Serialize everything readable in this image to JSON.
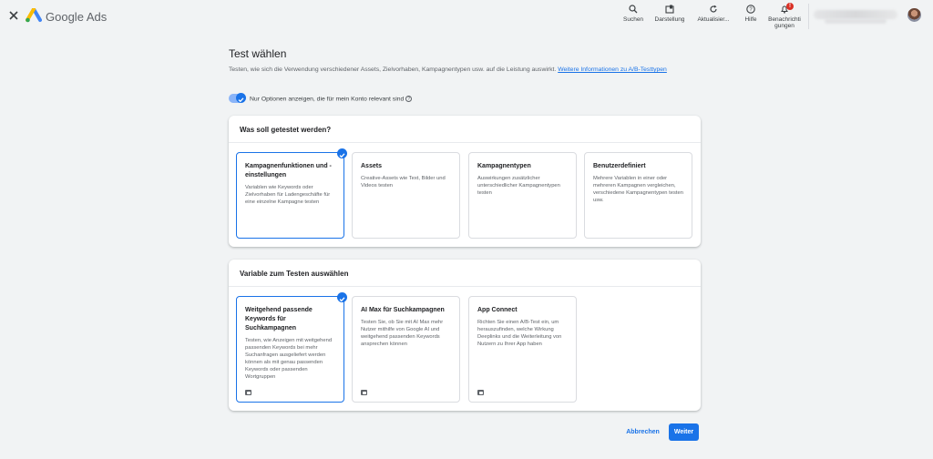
{
  "app": {
    "brand": "Google Ads"
  },
  "toolbar": [
    {
      "label": "Suchen",
      "icon": "search-icon"
    },
    {
      "label": "Darstellung",
      "icon": "appearance-icon"
    },
    {
      "label": "Aktualisier...",
      "icon": "refresh-icon"
    },
    {
      "label": "Hilfe",
      "icon": "help-icon"
    },
    {
      "label": "Benachrichti gungen",
      "icon": "bell-icon",
      "badge": "!"
    }
  ],
  "page": {
    "title": "Test wählen",
    "description": "Testen, wie sich die Verwendung verschiedener Assets, Zielvorhaben, Kampagnentypen usw. auf die Leistung auswirkt. ",
    "learn_more": "Weitere Informationen zu A/B-Testtypen",
    "toggle_label": "Nur Optionen anzeigen, die für mein Konto relevant sind"
  },
  "section1": {
    "title": "Was soll getestet werden?",
    "cards": [
      {
        "title": "Kampagnenfunktionen und -einstellungen",
        "desc": "Variablen wie Keywords oder Zielvorhaben für Ladengeschäfte für eine einzelne Kampagne testen",
        "selected": true
      },
      {
        "title": "Assets",
        "desc": "Creative-Assets wie Text, Bilder und Videos testen",
        "selected": false
      },
      {
        "title": "Kampagnentypen",
        "desc": "Auswirkungen zusätzlicher unterschiedlicher Kampagnentypen testen",
        "selected": false
      },
      {
        "title": "Benutzerdefiniert",
        "desc": "Mehrere Variablen in einer oder mehreren Kampagnen vergleichen, verschiedene Kampagnentypen testen usw.",
        "selected": false
      }
    ]
  },
  "section2": {
    "title": "Variable zum Testen auswählen",
    "cards": [
      {
        "title": "Weitgehend passende Keywords für Suchkampagnen",
        "desc": "Testen, wie Anzeigen mit weitgehend passenden Keywords bei mehr Suchanfragen ausgeliefert werden können als mit genau passenden Keywords oder passenden Wortgruppen",
        "selected": true
      },
      {
        "title": "AI Max für Suchkampagnen",
        "desc": "Testen Sie, ob Sie mit AI Max mehr Nutzer mithilfe von Google AI und weitgehend passenden Keywords ansprechen können",
        "selected": false
      },
      {
        "title": "App Connect",
        "desc": "Richten Sie einen A/B-Test ein, um herauszufinden, welche Wirkung Deeplinks und die Weiterleitung von Nutzern zu Ihrer App haben",
        "selected": false
      }
    ]
  },
  "footer": {
    "cancel": "Abbrechen",
    "next": "Weiter"
  },
  "colors": {
    "accent": "#1a73e8",
    "background": "#f1f3f4",
    "badge": "#d93025"
  }
}
